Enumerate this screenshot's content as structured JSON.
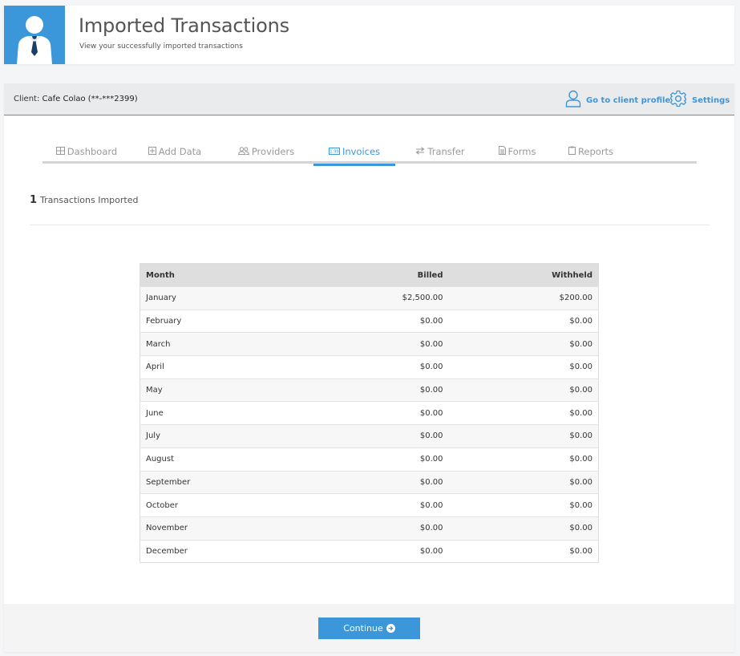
{
  "header": {
    "title": "Imported Transactions",
    "subtitle": "View your successfully imported transactions"
  },
  "client_bar": {
    "label_prefix": "Client: ",
    "client_name": "Cafe Colao (**-***2399)",
    "profile_link": "Go to client profile",
    "settings_link": "Settings"
  },
  "tabs": [
    {
      "label": "Dashboard",
      "icon": "grid-icon"
    },
    {
      "label": "Add Data",
      "icon": "plus-square-icon"
    },
    {
      "label": "Providers",
      "icon": "users-icon"
    },
    {
      "label": "Invoices",
      "icon": "invoice-icon",
      "active": true
    },
    {
      "label": "Transfer",
      "icon": "transfer-icon"
    },
    {
      "label": "Forms",
      "icon": "document-icon"
    },
    {
      "label": "Reports",
      "icon": "clipboard-icon"
    }
  ],
  "summary": {
    "count": "1",
    "label": "Transactions Imported"
  },
  "table": {
    "headers": [
      "Month",
      "Billed",
      "Withheld"
    ],
    "rows": [
      [
        "January",
        "$2,500.00",
        "$200.00"
      ],
      [
        "February",
        "$0.00",
        "$0.00"
      ],
      [
        "March",
        "$0.00",
        "$0.00"
      ],
      [
        "April",
        "$0.00",
        "$0.00"
      ],
      [
        "May",
        "$0.00",
        "$0.00"
      ],
      [
        "June",
        "$0.00",
        "$0.00"
      ],
      [
        "July",
        "$0.00",
        "$0.00"
      ],
      [
        "August",
        "$0.00",
        "$0.00"
      ],
      [
        "September",
        "$0.00",
        "$0.00"
      ],
      [
        "October",
        "$0.00",
        "$0.00"
      ],
      [
        "November",
        "$0.00",
        "$0.00"
      ],
      [
        "December",
        "$0.00",
        "$0.00"
      ]
    ]
  },
  "footer": {
    "continue_label": "Continue"
  },
  "colors": {
    "accent": "#3b97d9"
  }
}
